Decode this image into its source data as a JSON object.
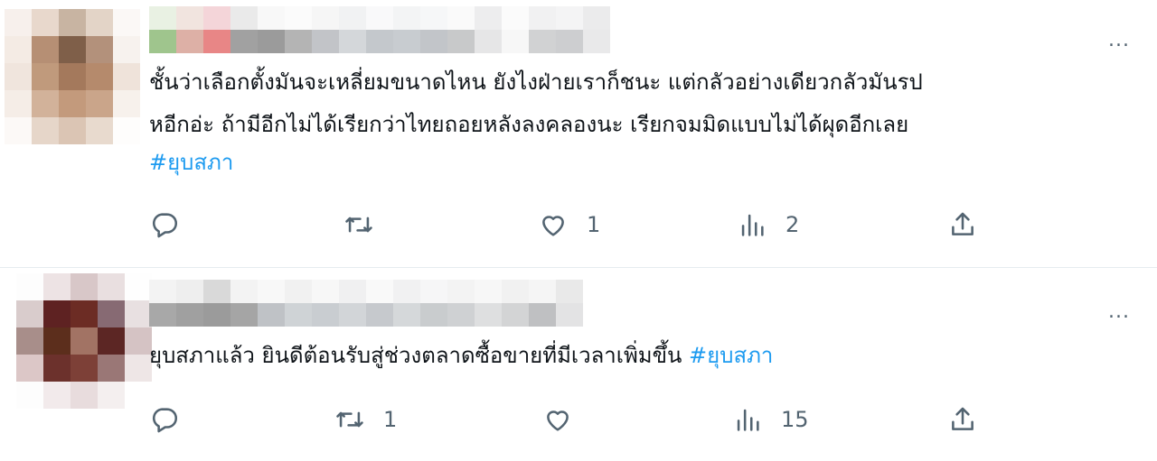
{
  "tweets": [
    {
      "text_line1": "ชั้นว่าเลือกตั้งมันจะเหลี่ยมขนาดไหน ยังไงฝ่ายเราก็ชนะ แต่กลัวอย่างเดียวกลัวมันรป",
      "text_line2": "หอีกอ่ะ ถ้ามีอีกไม่ได้เรียกว่าไทยถอยหลังลงคลองนะ เรียกจมมิดแบบไม่ได้ผุดอีกเลย",
      "hashtag": "#ยุบสภา",
      "more_label": "...",
      "reply_count": "",
      "retweet_count": "",
      "like_count": "1",
      "views_count": "2"
    },
    {
      "text": "ยุบสภาแล้ว ยินดีต้อนรับสู่ช่วงตลาดซื้อขายที่มีเวลาเพิ่มขึ้น ",
      "hashtag": "#ยุบสภา",
      "more_label": "...",
      "reply_count": "",
      "retweet_count": "1",
      "like_count": "",
      "views_count": "15"
    }
  ],
  "colors": {
    "hashtag": "#1d9bf0",
    "icon": "#536471",
    "divider": "#e6ecf0"
  },
  "icons": [
    "reply-icon",
    "retweet-icon",
    "like-icon",
    "views-icon",
    "share-icon",
    "more-icon"
  ]
}
